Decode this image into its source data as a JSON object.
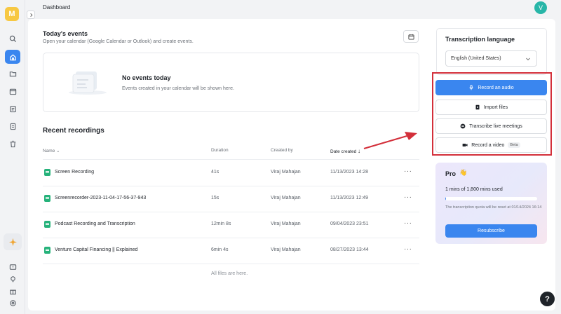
{
  "app": {
    "logo_letter": "M",
    "page_title": "Dashboard",
    "avatar_letter": "V"
  },
  "events": {
    "title": "Today's events",
    "subtitle": "Open your calendar (Google Calendar or Outlook) and create events.",
    "empty_title": "No events today",
    "empty_note": "Events created in your calendar will be shown here."
  },
  "recordings": {
    "title": "Recent recordings",
    "columns": {
      "name": "Name",
      "duration": "Duration",
      "created_by": "Created by",
      "date_created": "Date created"
    },
    "rows": [
      {
        "name": "Screen Recording",
        "duration": "41s",
        "created_by": "Viraj Mahajan",
        "date": "11/13/2023 14:28",
        "more": "···"
      },
      {
        "name": "Screenrecorder-2023-11-04-17-56-37-943",
        "duration": "15s",
        "created_by": "Viraj Mahajan",
        "date": "11/13/2023 12:49",
        "more": "···"
      },
      {
        "name": "Podcast Recording and Transcription",
        "duration": "12min 8s",
        "created_by": "Viraj Mahajan",
        "date": "09/04/2023 23:51",
        "more": "···"
      },
      {
        "name": "Venture Capital Financing || Explained",
        "duration": "6min 4s",
        "created_by": "Viraj Mahajan",
        "date": "08/27/2023 13:44",
        "more": "···"
      }
    ],
    "footer": "All files are here."
  },
  "transcription": {
    "title": "Transcription language",
    "language": "English (United States)"
  },
  "actions": {
    "record_audio": "Record an audio",
    "import_files": "Import files",
    "transcribe_live": "Transcribe live meetings",
    "record_video": "Record a video",
    "beta": "Beta"
  },
  "pro": {
    "title": "Pro",
    "hand": "👋",
    "usage": "1 mins of 1,800 mins used",
    "usage_fraction": 0.0006,
    "note": "The transcription quota will be reset at 01/14/2024 16:14",
    "button": "Resubscribe"
  },
  "help": "?",
  "colors": {
    "accent": "#3a86ef",
    "highlight_box": "#d32f3a",
    "file_icon": "#25b27a",
    "logo": "#f7c843",
    "avatar": "#28b6a8"
  },
  "icons": {
    "rail": [
      "search-icon",
      "home-icon",
      "folder-icon",
      "calendar-icon",
      "notes-icon",
      "document-icon",
      "trash-icon",
      "sparkle-icon",
      "feedback-icon",
      "lightbulb-icon",
      "gift-icon",
      "settings-icon"
    ]
  }
}
